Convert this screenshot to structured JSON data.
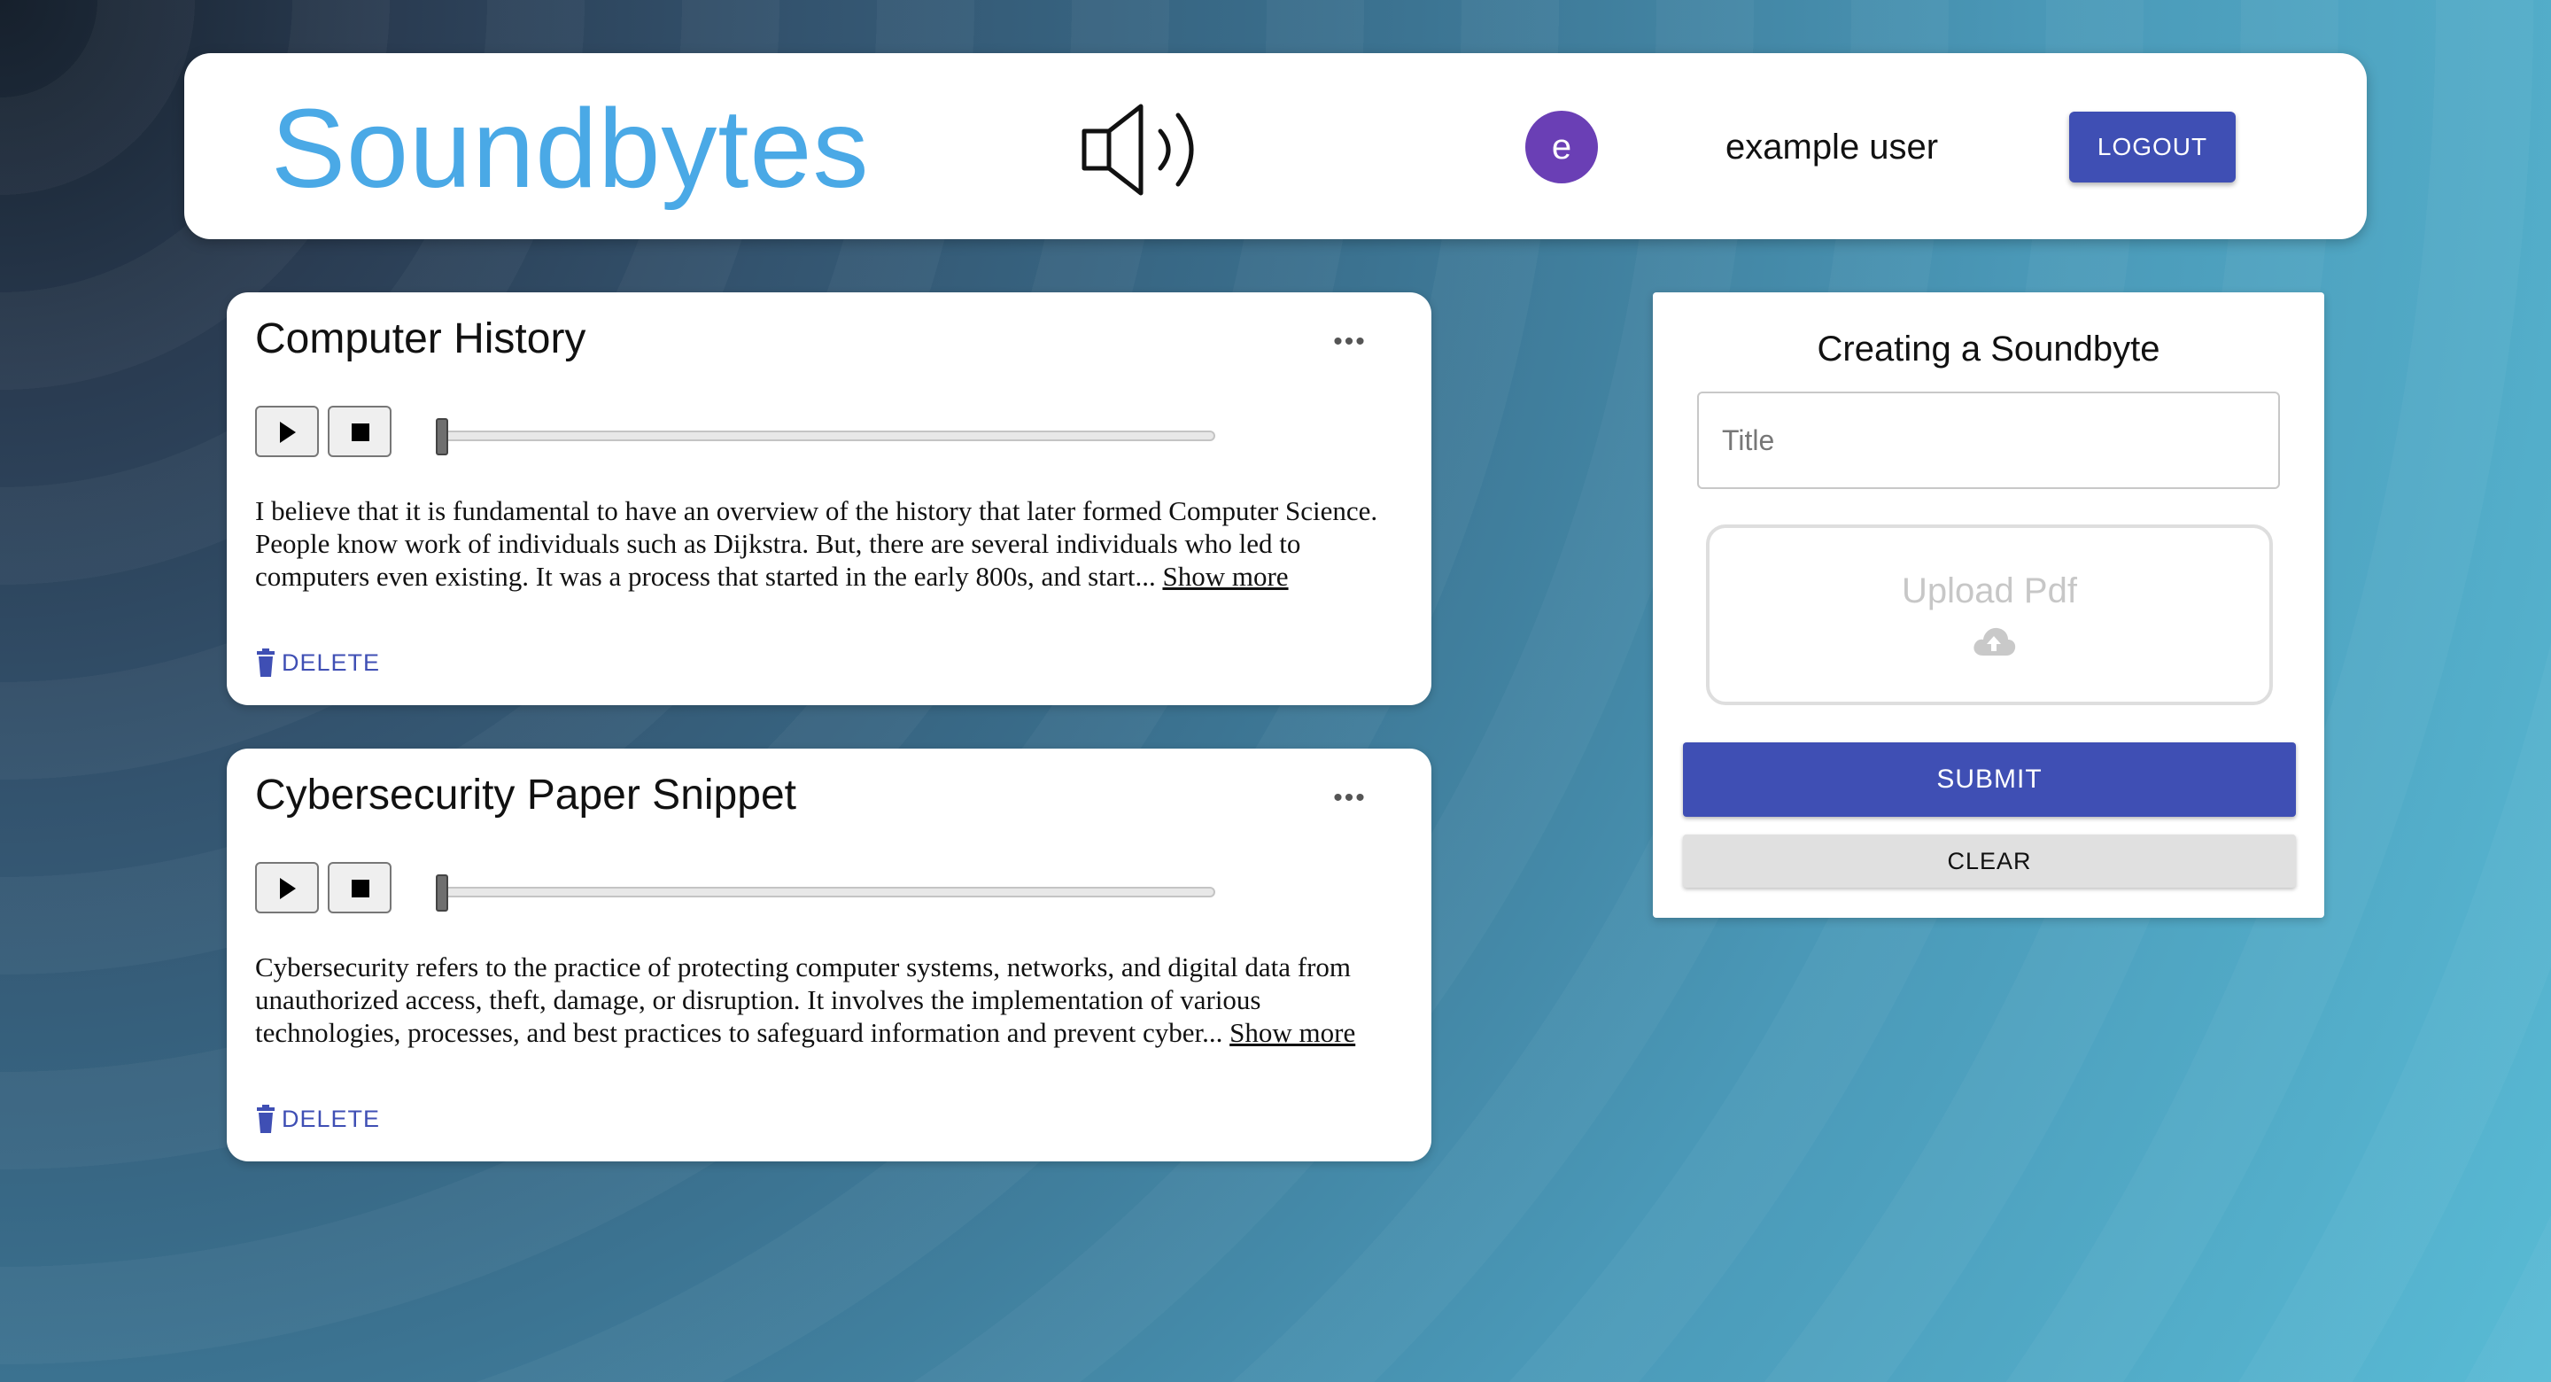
{
  "header": {
    "brand": "Soundbytes",
    "brand_color": "#4aa9e6",
    "speaker_icon": "speaker-icon",
    "avatar_letter": "e",
    "avatar_color": "#6a3fb5",
    "username": "example user",
    "logout_label": "LOGOUT"
  },
  "soundbytes": [
    {
      "title": "Computer History",
      "menu_label": "•••",
      "text": "I believe that it is fundamental to have an overview of the history that later formed Computer Science. People know work of individuals such as Dijkstra. But, there are several individuals who led to computers even existing. It was a process that started in the early 800s, and start...",
      "show_more": "Show more",
      "delete_label": "DELETE",
      "progress": 0
    },
    {
      "title": "Cybersecurity Paper Snippet",
      "menu_label": "•••",
      "text": "Cybersecurity refers to the practice of protecting computer systems, networks, and digital data from unauthorized access, theft, damage, or disruption. It involves the implementation of various technologies, processes, and best practices to safeguard information and prevent cyber...",
      "show_more": "Show more",
      "delete_label": "DELETE",
      "progress": 0
    }
  ],
  "form": {
    "title": "Creating a Soundbyte",
    "title_placeholder": "Title",
    "upload_label": "Upload Pdf",
    "submit_label": "SUBMIT",
    "clear_label": "CLEAR"
  },
  "colors": {
    "primary_button": "#3f4fb4"
  }
}
